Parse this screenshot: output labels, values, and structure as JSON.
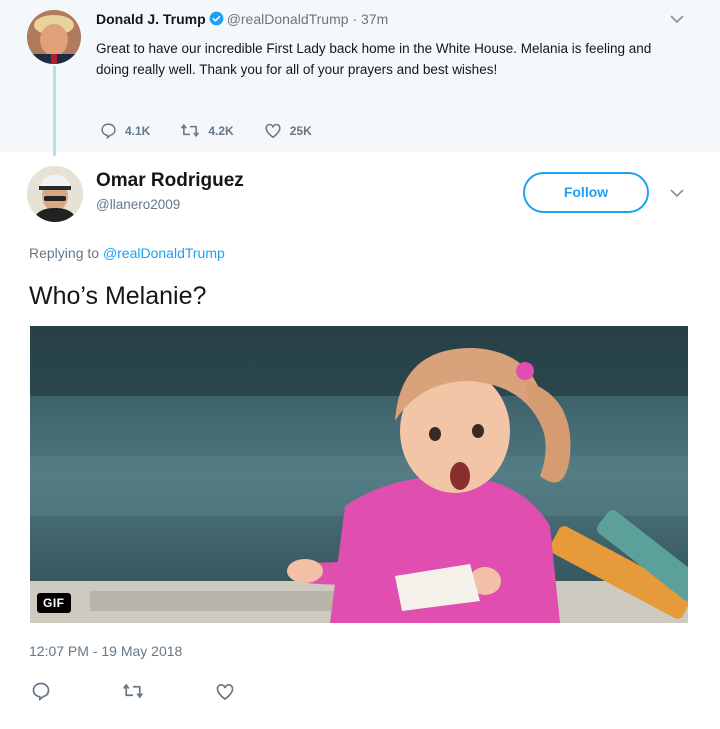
{
  "parent_tweet": {
    "author_name": "Donald J. Trump",
    "author_handle": "@realDonaldTrump",
    "separator": "·",
    "time": "37m",
    "text": "Great to have our incredible First Lady back home in the White House. Melania is feeling and doing really well. Thank you for all of your prayers and best wishes!",
    "replies": "4.1K",
    "retweets": "4.2K",
    "likes": "25K"
  },
  "reply_tweet": {
    "author_name": "Omar Rodriguez",
    "author_handle": "@llanero2009",
    "follow_label": "Follow",
    "replying_prefix": "Replying to",
    "replying_to": "@realDonaldTrump",
    "text": "Who’s Melanie?",
    "media_badge": "GIF",
    "timestamp": "12:07 PM - 19 May 2018"
  },
  "icons": {
    "verified": "verified-badge-icon",
    "reply": "reply-icon",
    "retweet": "retweet-icon",
    "like": "heart-icon",
    "more": "chevron-down-icon"
  },
  "colors": {
    "accent": "#1da1f2",
    "secondary_text": "#657786",
    "parent_background": "#f5f8fa",
    "thread_line": "#b8e0ea"
  }
}
